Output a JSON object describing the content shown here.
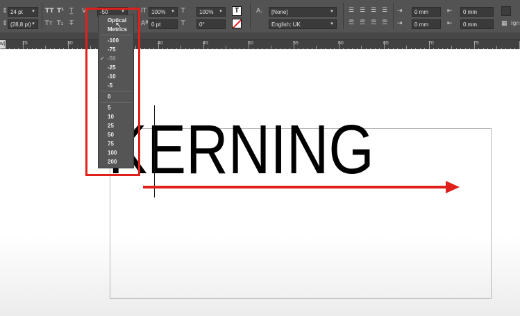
{
  "toolbar": {
    "font_size": "24 pt",
    "leading": "(28,8 pt)",
    "kerning": "-50",
    "vertical_scale": "100%",
    "horizontal_scale": "100%",
    "baseline_shift": "0 pt",
    "skew": "0°",
    "char_style": "[None]",
    "language": "English: UK",
    "left_indent": "0 mm",
    "right_indent": "0 mm",
    "first_line_indent": "0 mm",
    "last_line_indent": "0 mm",
    "ign": "Ign",
    "icons": [
      "all-caps-icon",
      "superscript-icon",
      "underline-icon",
      "small-caps-icon",
      "subscript-icon",
      "strikethrough-icon",
      "kerning-icon",
      "tracking-icon",
      "vertical-scale-icon",
      "horizontal-scale-icon",
      "baseline-shift-icon",
      "skew-icon",
      "fill-icon",
      "stroke-icon",
      "char-style-icon",
      "align-left-icon",
      "align-center-icon",
      "align-right-icon",
      "justify-icon"
    ]
  },
  "tab_label": "w]",
  "ruler": {
    "labels": [
      "25",
      "30",
      "35",
      "40",
      "45",
      "50",
      "55",
      "60",
      "65",
      "70",
      "75"
    ]
  },
  "kerning_menu": {
    "items": [
      {
        "label": "Optical",
        "selected": false,
        "dim": false
      },
      {
        "label": "Metrics",
        "selected": false,
        "dim": false
      },
      {
        "label": "-100",
        "selected": false,
        "dim": false
      },
      {
        "label": "-75",
        "selected": false,
        "dim": false
      },
      {
        "label": "-50",
        "selected": true,
        "dim": true
      },
      {
        "label": "-25",
        "selected": false,
        "dim": false
      },
      {
        "label": "-10",
        "selected": false,
        "dim": false
      },
      {
        "label": "-5",
        "selected": false,
        "dim": false
      },
      {
        "label": "0",
        "selected": false,
        "dim": false
      },
      {
        "label": "5",
        "selected": false,
        "dim": false
      },
      {
        "label": "10",
        "selected": false,
        "dim": false
      },
      {
        "label": "25",
        "selected": false,
        "dim": false
      },
      {
        "label": "50",
        "selected": false,
        "dim": false
      },
      {
        "label": "75",
        "selected": false,
        "dim": false
      },
      {
        "label": "100",
        "selected": false,
        "dim": false
      },
      {
        "label": "200",
        "selected": false,
        "dim": false
      }
    ],
    "check_glyph": "✓"
  },
  "document": {
    "headline": "KERNING"
  },
  "colors": {
    "highlight_red": "#e0201b",
    "panel_bg": "#535353"
  }
}
